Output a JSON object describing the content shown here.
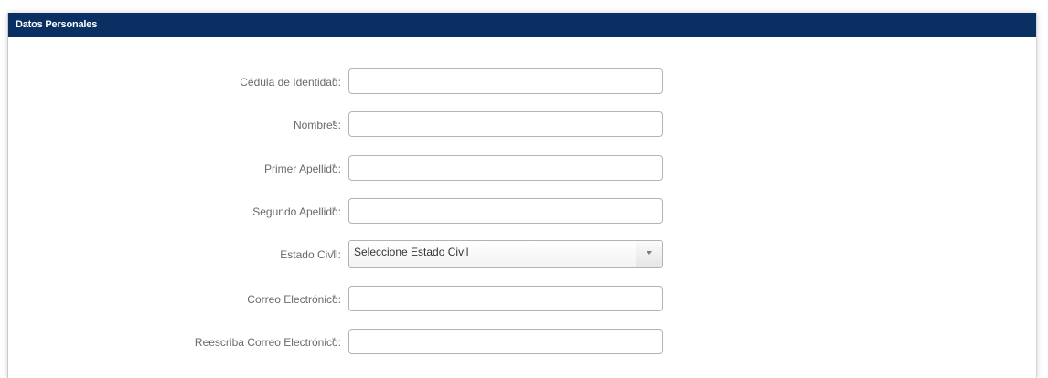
{
  "section": {
    "title": "Datos Personales"
  },
  "fields": [
    {
      "label": "Cédula de Identidad:",
      "required": "*",
      "value": "",
      "placeholder": ""
    },
    {
      "label": "Nombres:",
      "required": "*",
      "value": "",
      "placeholder": ""
    },
    {
      "label": "Primer Apellido:",
      "required": "*",
      "value": "",
      "placeholder": ""
    },
    {
      "label": "Segundo Apellido:",
      "required": "*",
      "value": "",
      "placeholder": ""
    },
    {
      "label": "Estado Civil:",
      "required": "*",
      "selected": "Seleccione Estado Civil"
    },
    {
      "label": "Correo Electrónico:",
      "required": "*",
      "value": "",
      "placeholder": ""
    },
    {
      "label": "Reescriba Correo Electrónico:",
      "required": "*",
      "value": "",
      "placeholder": ""
    }
  ],
  "colors": {
    "header_bg": "#0a2f63",
    "header_text": "#ffffff",
    "label_text": "#6a6a6a",
    "input_border": "#b3b3b3"
  }
}
